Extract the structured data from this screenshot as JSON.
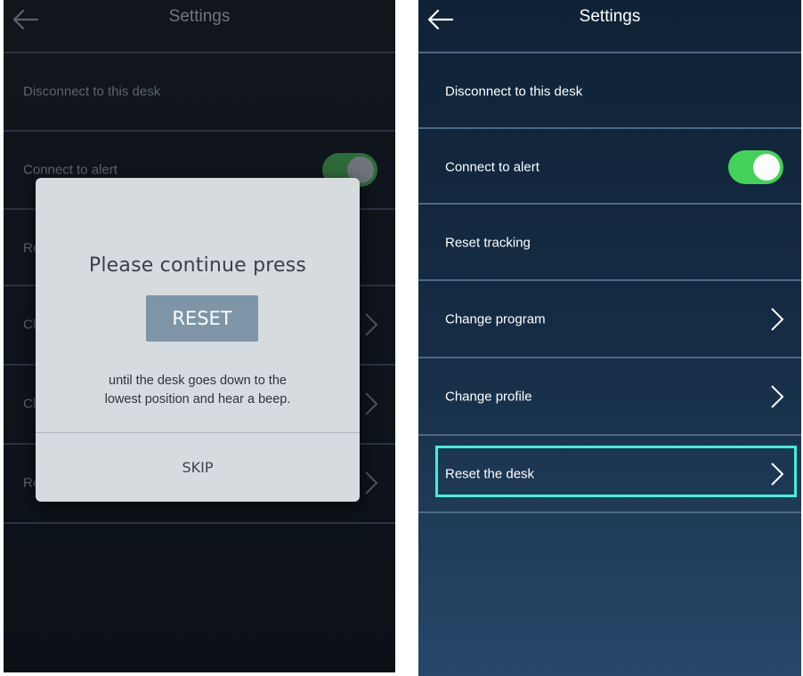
{
  "colors": {
    "toggle_on": "#43d15a",
    "highlight": "#3ff0de",
    "modal_button": "#7e95a7"
  },
  "left_screen": {
    "header": {
      "title": "Settings",
      "back_icon": "arrow-left-icon"
    },
    "rows": [
      {
        "label": "Disconnect to this desk"
      },
      {
        "label": "Connect to alert",
        "toggle": "on"
      },
      {
        "label": "Re"
      },
      {
        "label": "Cl",
        "chevron": "chevron-right-icon"
      },
      {
        "label": "Cl",
        "chevron": "chevron-right-icon"
      },
      {
        "label": "Re",
        "chevron": "chevron-right-icon"
      }
    ],
    "modal": {
      "title": "Please continue press",
      "button_label": "RESET",
      "body_line1": "until the desk goes down to the",
      "body_line2": "lowest position and hear a beep.",
      "skip_label": "SKIP"
    }
  },
  "right_screen": {
    "header": {
      "title": "Settings",
      "back_icon": "arrow-left-icon"
    },
    "rows": [
      {
        "label": "Disconnect to this desk"
      },
      {
        "label": "Connect to alert",
        "toggle": "on"
      },
      {
        "label": "Reset tracking"
      },
      {
        "label": "Change program",
        "chevron": "chevron-right-icon"
      },
      {
        "label": "Change profile",
        "chevron": "chevron-right-icon"
      },
      {
        "label": "Reset the desk",
        "chevron": "chevron-right-icon",
        "highlighted": true
      }
    ]
  }
}
